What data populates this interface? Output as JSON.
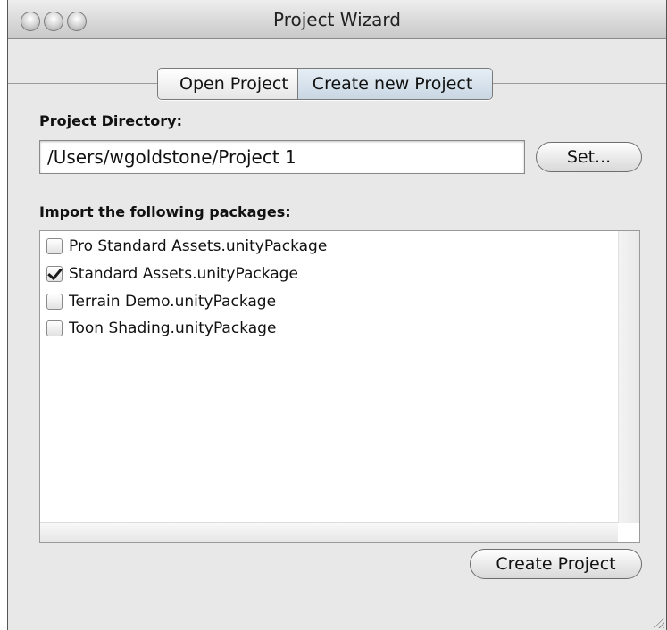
{
  "window": {
    "title": "Project Wizard"
  },
  "tabs": [
    {
      "label": "Open Project",
      "selected": false
    },
    {
      "label": "Create new Project",
      "selected": true
    }
  ],
  "project_directory": {
    "label": "Project Directory:",
    "value": "/Users/wgoldstone/Project 1",
    "set_button": "Set..."
  },
  "packages": {
    "label": "Import the following packages:",
    "items": [
      {
        "label": "Pro Standard Assets.unityPackage",
        "checked": false
      },
      {
        "label": "Standard Assets.unityPackage",
        "checked": true
      },
      {
        "label": "Terrain Demo.unityPackage",
        "checked": false
      },
      {
        "label": "Toon Shading.unityPackage",
        "checked": false
      }
    ]
  },
  "create_button": "Create Project",
  "icons": [
    "close-button-icon",
    "minimize-button-icon",
    "zoom-button-icon",
    "checkmark-icon",
    "resize-grip-icon"
  ]
}
